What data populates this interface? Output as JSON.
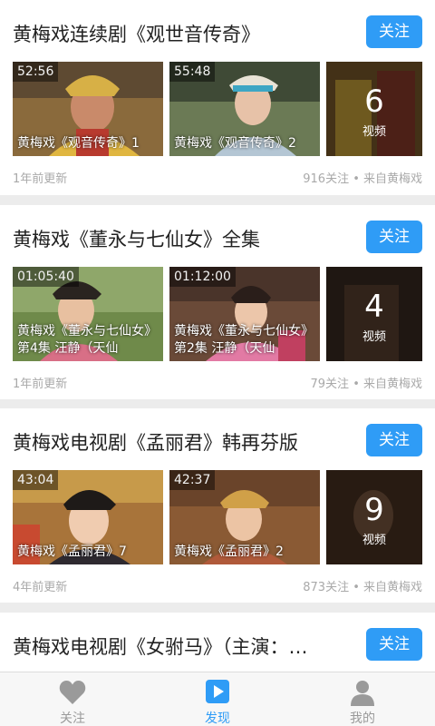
{
  "feed": [
    {
      "title": "黄梅戏连续剧《观世音传奇》",
      "follow_label": "关注",
      "videos": [
        {
          "duration": "52:56",
          "caption": "黄梅戏《观音传奇》1"
        },
        {
          "duration": "55:48",
          "caption": "黄梅戏《观音传奇》2"
        }
      ],
      "more_count": "6",
      "more_label": "视频",
      "updated": "1年前更新",
      "meta": "916关注 • 来自黄梅戏"
    },
    {
      "title": "黄梅戏《董永与七仙女》全集",
      "follow_label": "关注",
      "videos": [
        {
          "duration": "01:05:40",
          "caption": "黄梅戏《董永与七仙女》第4集 汪静（天仙"
        },
        {
          "duration": "01:12:00",
          "caption": "黄梅戏《董永与七仙女》第2集 汪静（天仙"
        }
      ],
      "more_count": "4",
      "more_label": "视频",
      "updated": "1年前更新",
      "meta": "79关注 • 来自黄梅戏"
    },
    {
      "title": "黄梅戏电视剧《孟丽君》韩再芬版",
      "follow_label": "关注",
      "videos": [
        {
          "duration": "43:04",
          "caption": "黄梅戏《孟丽君》7"
        },
        {
          "duration": "42:37",
          "caption": "黄梅戏《孟丽君》2"
        }
      ],
      "more_count": "9",
      "more_label": "视频",
      "updated": "4年前更新",
      "meta": "873关注 • 来自黄梅戏"
    },
    {
      "title": "黄梅戏电视剧《女驸马》（主演：…",
      "follow_label": "关注"
    }
  ],
  "bottom_nav": [
    {
      "label": "关注",
      "icon": "heart-icon",
      "active": false
    },
    {
      "label": "发现",
      "icon": "play-icon",
      "active": true
    },
    {
      "label": "我的",
      "icon": "person-icon",
      "active": false
    }
  ],
  "colors": {
    "accent": "#2f9cf6",
    "inactive": "#9a9a9a"
  }
}
